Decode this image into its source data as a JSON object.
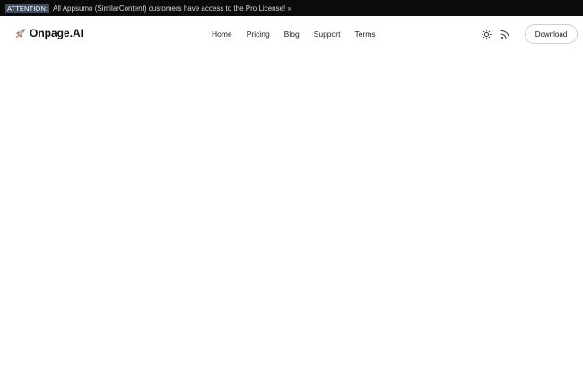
{
  "announcement": {
    "tag": "ATTENTION:",
    "text": "All Appsumo (SimilarContent) customers have access to the Pro License! »"
  },
  "header": {
    "brand": {
      "icon": "rocket-icon",
      "name": "Onpage.AI"
    },
    "nav": [
      {
        "label": "Home"
      },
      {
        "label": "Pricing"
      },
      {
        "label": "Blog"
      },
      {
        "label": "Support"
      },
      {
        "label": "Terms"
      }
    ],
    "tools": {
      "theme_icon": "sun-icon",
      "rss_icon": "rss-icon"
    },
    "download_label": "Download"
  },
  "colors": {
    "announce_bg": "#0b0b0b",
    "announce_tag_bg": "#3f4a5a",
    "page_bg": "#ffffff",
    "text": "#111111"
  }
}
